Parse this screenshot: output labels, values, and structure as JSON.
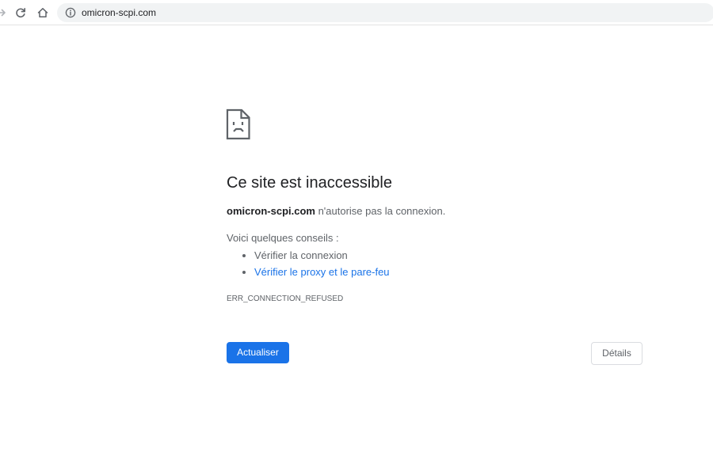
{
  "browser": {
    "url": "omicron-scpi.com",
    "icons": {
      "forward": "arrow-forward-icon",
      "reload": "reload-icon",
      "home": "home-icon",
      "site_info": "info-icon"
    }
  },
  "error_page": {
    "icon": "sad-document-icon",
    "title": "Ce site est inaccessible",
    "message": {
      "host": "omicron-scpi.com",
      "text": " n'autorise pas la connexion."
    },
    "suggestions_heading": "Voici quelques conseils :",
    "suggestions": [
      {
        "label": "Vérifier la connexion",
        "is_link": false
      },
      {
        "label": "Vérifier le proxy et le pare-feu",
        "is_link": true
      }
    ],
    "error_code": "ERR_CONNECTION_REFUSED",
    "buttons": {
      "reload": "Actualiser",
      "details": "Détails"
    }
  },
  "colors": {
    "accent": "#1a73e8",
    "title_text": "#202124",
    "body_text": "#5f6368",
    "omnibox_bg": "#f1f3f4"
  }
}
